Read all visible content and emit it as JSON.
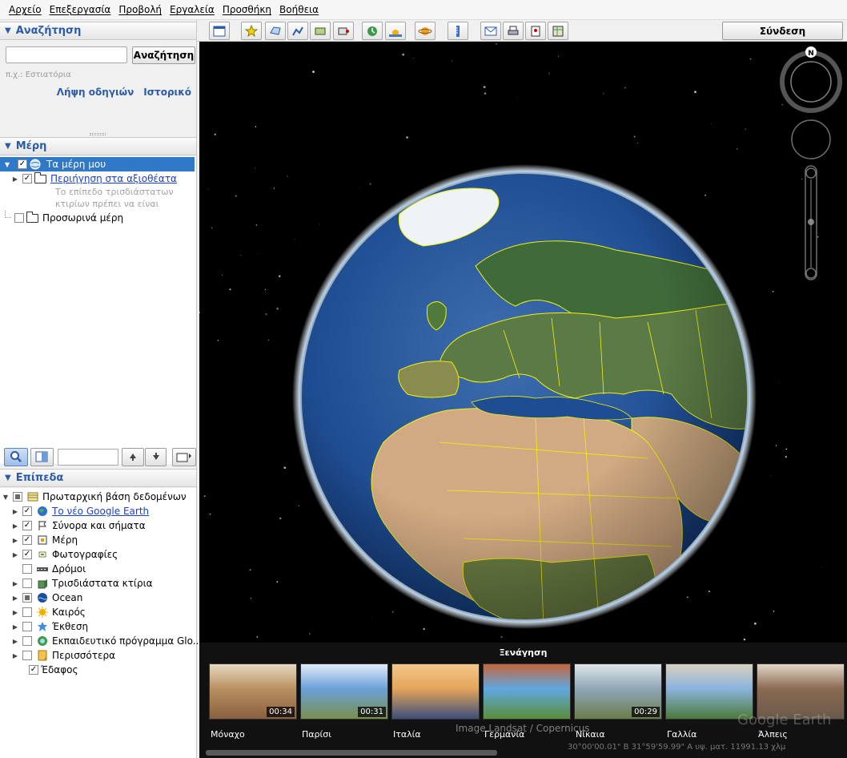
{
  "menu": [
    "Αρχείο",
    "Επεξεργασία",
    "Προβολή",
    "Εργαλεία",
    "Προσθήκη",
    "Βοήθεια"
  ],
  "search": {
    "header": "Αναζήτηση",
    "input_value": "",
    "button_label": "Αναζήτηση",
    "hint": "π.χ.: Εστιατόρια",
    "link_directions": "Λήψη οδηγιών",
    "link_history": "Ιστορικό"
  },
  "places": {
    "header": "Μέρη",
    "my_places": "Τα μέρη μου",
    "sightseeing": "Περιήγηση στα αξιοθέατα",
    "sightseeing_note_1": "Το επίπεδο τρισδιάστατων",
    "sightseeing_note_2": "κτιρίων πρέπει να είναι",
    "temporary": "Προσωρινά μέρη"
  },
  "layers": {
    "header": "Επίπεδα",
    "search_value": "",
    "items": [
      {
        "label": "Πρωταρχική βάση δεδομένων",
        "check": "partial",
        "expander": "open",
        "icon": "database-icon",
        "link": false
      },
      {
        "label": "Το νέο Google Earth",
        "check": "checked",
        "expander": "closed",
        "icon": "earth-icon",
        "link": true
      },
      {
        "label": "Σύνορα και σήματα",
        "check": "checked",
        "expander": "closed",
        "icon": "flag-icon",
        "link": false
      },
      {
        "label": "Μέρη",
        "check": "checked",
        "expander": "closed",
        "icon": "places-layer-icon",
        "link": false
      },
      {
        "label": "Φωτογραφίες",
        "check": "checked",
        "expander": "closed",
        "icon": "photos-icon",
        "link": false
      },
      {
        "label": "Δρόμοι",
        "check": "unchecked",
        "expander": "none",
        "icon": "roads-icon",
        "link": false
      },
      {
        "label": "Τρισδιάστατα κτίρια",
        "check": "unchecked",
        "expander": "closed",
        "icon": "buildings-icon",
        "link": false
      },
      {
        "label": "Ocean",
        "check": "partial",
        "expander": "closed",
        "icon": "ocean-icon",
        "link": false
      },
      {
        "label": "Καιρός",
        "check": "unchecked",
        "expander": "closed",
        "icon": "weather-icon",
        "link": false
      },
      {
        "label": "Έκθεση",
        "check": "unchecked",
        "expander": "closed",
        "icon": "gallery-icon",
        "link": false
      },
      {
        "label": "Εκπαιδευτικό πρόγραμμα Glo...",
        "check": "unchecked",
        "expander": "closed",
        "icon": "outreach-icon",
        "link": false
      },
      {
        "label": "Περισσότερα",
        "check": "unchecked",
        "expander": "closed",
        "icon": "more-icon",
        "link": false
      },
      {
        "label": "Έδαφος",
        "check": "checked",
        "expander": "none",
        "icon": "",
        "link": false
      }
    ]
  },
  "toolbar": {
    "tools": [
      "sidebar-toggle-icon",
      "placemark-icon",
      "polygon-icon",
      "path-icon",
      "overlay-icon",
      "tour-record-icon",
      "historical-imagery-icon",
      "sunlight-icon",
      "planets-icon",
      "ruler-icon",
      "email-icon",
      "print-icon",
      "save-image-icon",
      "maps-view-icon"
    ],
    "signin_label": "Σύνδεση"
  },
  "navigation": {
    "north_label": "N"
  },
  "tour": {
    "title": "Ξενάγηση",
    "items": [
      {
        "label": "Μόναχο",
        "duration": "00:34"
      },
      {
        "label": "Παρίσι",
        "duration": "00:31"
      },
      {
        "label": "Ιταλία",
        "duration": ""
      },
      {
        "label": "Γερμανία",
        "duration": ""
      },
      {
        "label": "Νίκαια",
        "duration": "00:29"
      },
      {
        "label": "Γαλλία",
        "duration": ""
      },
      {
        "label": "Άλπεις",
        "duration": ""
      }
    ],
    "attribution": "Image Landsat / Copernicus",
    "watermark": "Google Earth",
    "coords": "30°00'00.01\" B    31°59'59.99\" A  υψ. ματ. 11991.13 χλμ"
  },
  "colors": {
    "accent": "#2c5ca8",
    "selection": "#3079c8",
    "link": "#1a3fd1",
    "border_lines": "#f2f20a"
  }
}
